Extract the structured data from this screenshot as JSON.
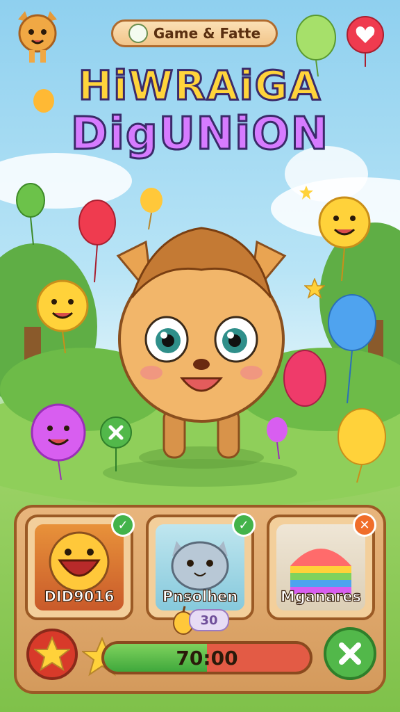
{
  "header": {
    "pill_text": "Game & Fatte"
  },
  "logo": {
    "line1": "HiWRAiGA",
    "line2": "DigUNiON"
  },
  "cards": [
    {
      "label": "DID9016",
      "status": "ok"
    },
    {
      "label": "Pnsolhen",
      "status": "ok"
    },
    {
      "label": "Mganares",
      "status": "close"
    }
  ],
  "counter": {
    "value": "30"
  },
  "progress": {
    "text": "70:00",
    "fraction": 0.5
  },
  "colors": {
    "panel": "#d49a5c",
    "progress_fill": "#3fa83c",
    "progress_bg": "#e35b45"
  },
  "icons": [
    "star-icon",
    "close-icon",
    "heart-icon",
    "check-icon"
  ]
}
